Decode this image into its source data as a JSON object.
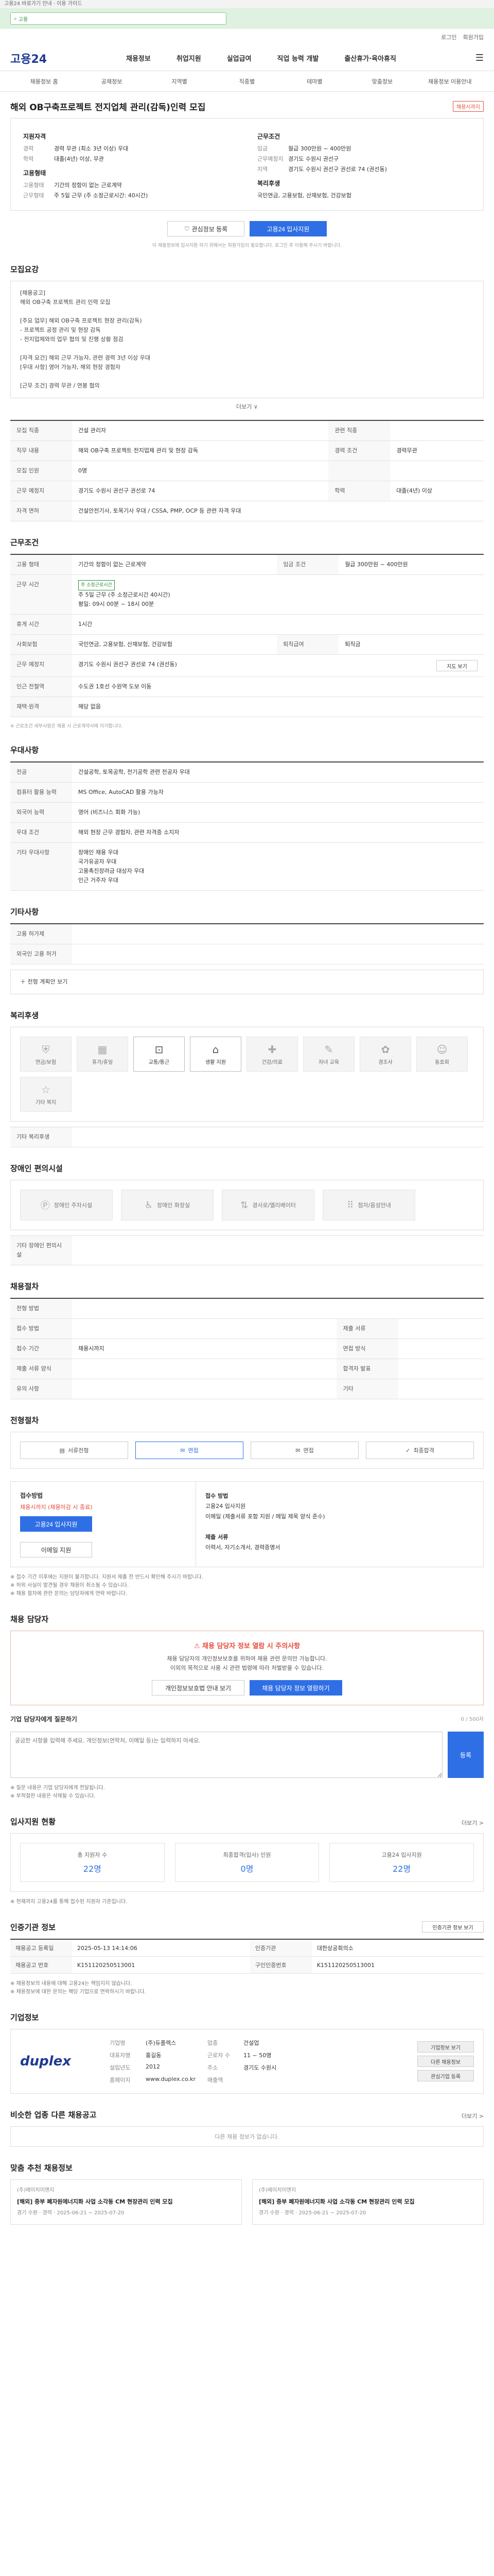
{
  "topbar": {
    "text": "고용24 바로가기 안내 · 이용 가이드"
  },
  "topsearch": {
    "label": "고용"
  },
  "util": [
    "로그인",
    "회원가입"
  ],
  "header": {
    "logo": "고용24",
    "nav": [
      "채용정보",
      "취업지원",
      "실업급여",
      "직업 능력 개발",
      "출산휴가·육아휴직"
    ]
  },
  "subnav": [
    "채용정보 홈",
    "공채정보",
    "지역별",
    "직종별",
    "테마별",
    "맞춤정보",
    "채용정보 이용안내"
  ],
  "job": {
    "title": "해외 OB구축프로젝트 전지업체 관리(감독)인력 모집",
    "badge": "채용시까지",
    "summary": {
      "left_title": "지원자격",
      "left": [
        {
          "k": "경력",
          "v": "경력 무관 (최소 3년 이상) 우대"
        },
        {
          "k": "학력",
          "v": "대졸(4년) 이상, 무관"
        }
      ],
      "left_title2": "고용형태",
      "left2": [
        {
          "k": "고용형태",
          "v": "기간의 정함이 없는 근로계약"
        },
        {
          "k": "근무형태",
          "v": "주 5일 근무 (주 소정근로시간: 40시간)"
        }
      ],
      "right_title": "근무조건",
      "right": [
        {
          "k": "임금",
          "v": "월급 300만원 ~ 400만원"
        },
        {
          "k": "근무예정지",
          "v": "경기도 수원시 권선구"
        },
        {
          "k": "지역",
          "v": "경기도 수원시 권선구 권선로 74 (권선동)"
        }
      ],
      "right_title2": "복리후생",
      "right2": [
        {
          "k": "",
          "v": "국민연금, 고용보험, 산재보험, 건강보험"
        }
      ]
    },
    "btn_interest": "관심정보 등록",
    "btn_apply": "고용24 입사지원",
    "note": "이 채용정보에 입사지원 하기 위해서는 회원가입이 필요합니다. 로그인 후 이용해 주시기 바랍니다."
  },
  "recruit": {
    "h": "모집요강",
    "lines": [
      "[채용공고]",
      "해외 OB구축 프로젝트 관리 인력 모집",
      "",
      "[주요 업무] 해외 OB구축 프로젝트 현장 관리(감독)",
      "- 프로젝트 공정 관리 및 현장 감독",
      "- 전지업체와의 업무 협의 및 진행 상황 점검",
      "",
      "[자격 요건] 해외 근무 가능자, 관련 경력 3년 이상 우대",
      "[우대 사항] 영어 가능자, 해외 현장 경험자",
      "",
      "[근무 조건] 경력 무관 / 연봉 협의"
    ],
    "more": "더보기 ∨"
  },
  "detail": {
    "rows1": [
      [
        {
          "k": "모집 직종",
          "v": "건설 관리자"
        },
        {
          "k": "관련 직종",
          "v": ""
        }
      ],
      [
        {
          "k": "직무 내용",
          "v": "해외 OB구축 프로젝트 전지업체 관리 및 현장 감독"
        },
        {
          "k": "경력 조건",
          "v": "경력무관"
        }
      ],
      [
        {
          "k": "모집 인원",
          "v": "0명"
        },
        {
          "k": "",
          "v": ""
        }
      ],
      [
        {
          "k": "근무 예정지",
          "v": "경기도 수원시 권선구 권선로 74"
        },
        {
          "k": "학력",
          "v": "대졸(4년) 이상"
        }
      ],
      [
        {
          "k": "자격 면허",
          "v": "건설안전기사, 토목기사 우대 / CSSA, PMP, OCP 등 관련 자격 우대"
        },
        {
          "k": "",
          "v": ""
        }
      ]
    ]
  },
  "conditions": {
    "h": "근무조건",
    "emp_type": "기간의 정함이 없는 근로계약",
    "wage": "월급 300만원 ~ 400만원",
    "hours_chip": "주 소정근로시간",
    "hours": "주 5일 근무 (주 소정근로시간 40시간)",
    "hours_detail": "평일: 09시 00분 ~ 18시 00분",
    "rows": [
      {
        "k": "휴게 시간",
        "v": "1시간"
      },
      {
        "k": "사회보험",
        "v": "국민연금, 고용보험, 산재보험, 건강보험"
      },
      {
        "k": "퇴직급여",
        "v": "퇴직금"
      },
      {
        "k": "근무 예정지",
        "v": "경기도 수원시 권선구 권선로 74 (권선동)"
      },
      {
        "k": "인근 전철역",
        "v": "수도권 1호선 수원역 도보 이동"
      },
      {
        "k": "재택·원격",
        "v": "해당 없음"
      }
    ],
    "map_btn": "지도 보기",
    "note": "※ 근로조건 세부사항은 채용 시 근로계약서에 의거합니다."
  },
  "welfare": {
    "h": "우대사항",
    "rows": [
      {
        "k": "전공",
        "v": "건설공학, 토목공학, 전기공학 관련 전공자 우대"
      },
      {
        "k": "컴퓨터 활용 능력",
        "v": "MS Office, AutoCAD 활용 가능자"
      },
      {
        "k": "외국어 능력",
        "v": "영어 (비즈니스 회화 가능)"
      },
      {
        "k": "우대 조건",
        "v": "해외 현장 근무 경험자, 관련 자격증 소지자"
      },
      {
        "k": "기타 우대사항",
        "v": "장애인 채용 우대\n국가유공자 우대\n고용촉진장려금 대상자 우대\n인근 거주자 우대"
      }
    ]
  },
  "other": {
    "h": "기타사항",
    "rows": [
      {
        "k": "고용 허가제",
        "v": ""
      },
      {
        "k": "외국인 고용 허가",
        "v": ""
      }
    ],
    "btn": "전형 계획안 보기"
  },
  "benefits": {
    "h": "복리후생",
    "items": [
      {
        "n": "연금/보험",
        "on": false
      },
      {
        "n": "휴가/휴일",
        "on": false
      },
      {
        "n": "교통/통근",
        "on": true
      },
      {
        "n": "생활 지원",
        "on": true
      },
      {
        "n": "건강/의료",
        "on": false
      },
      {
        "n": "자녀 교육",
        "on": false
      },
      {
        "n": "경조사",
        "on": false
      },
      {
        "n": "동호회",
        "on": false
      },
      {
        "n": "기타 복지",
        "on": false
      }
    ],
    "sub_h": "기타 복리후생",
    "sub_v": ""
  },
  "disability": {
    "h": "장애인 편의시설",
    "items": [
      "장애인 주차시설",
      "장애인 화장실",
      "경사로/엘리베이터",
      "점자/음성안내"
    ],
    "sub_h": "기타 장애인 편의시설",
    "sub_v": ""
  },
  "selection": {
    "h": "채용절차",
    "rows": [
      {
        "k": "전형 방법",
        "v": ""
      },
      {
        "k": "접수 방법",
        "v": "",
        "k2": "제출 서류",
        "v2": ""
      },
      {
        "k": "접수 기간",
        "v": "채용시까지",
        "k2": "면접 방식",
        "v2": ""
      },
      {
        "k": "제출 서류 양식",
        "v": "",
        "k2": "합격자 발표",
        "v2": ""
      },
      {
        "k": "유의 사항",
        "v": "",
        "k2": "기타",
        "v2": ""
      }
    ]
  },
  "process": {
    "h": "전형절차",
    "steps": [
      "서류전형",
      "면접",
      "면접",
      "최종합격"
    ],
    "active": 1
  },
  "apply": {
    "h_left": "접수방법",
    "deadline_label": "채용시까지 (채용마감 시 종료)",
    "btn_apply": "고용24 입사지원",
    "btn_email": "이메일 지원",
    "right_title": "접수 방법",
    "right": [
      "고용24 입사지원",
      "이메일 (제출서류 포함 지원 / 메일 제목 양식 준수)",
      "",
      "제출 서류",
      "이력서, 자기소개서, 경력증명서"
    ],
    "notes": [
      "※ 접수 기간 이후에는 지원이 불가합니다. 지원서 제출 전 반드시 확인해 주시기 바랍니다.",
      "※ 허위 사실이 발견될 경우 채용이 취소될 수 있습니다.",
      "※ 채용 절차에 관한 문의는 담당자에게 연락 바랍니다."
    ]
  },
  "contact": {
    "h": "채용 담당자",
    "warn_title": "채용 담당자 정보 열람 시 주의사항",
    "warn_lines": [
      "채용 담당자의 개인정보보호를 위하여 채용 관련 문의만 가능합니다.",
      "이외의 목적으로 사용 시 관련 법령에 따라 처벌받을 수 있습니다."
    ],
    "btn1": "개인정보보호법 안내 보기",
    "btn2": "채용 담당자 정보 열람하기",
    "qna_h": "기업 담당자에게 질문하기",
    "qna_count": "0 / 500자",
    "qna_placeholder": "궁금한 사항을 입력해 주세요. 개인정보(연락처, 이메일 등)는 입력하지 마세요.",
    "qna_btn": "등록",
    "qna_notes": [
      "※ 질문 내용은 기업 담당자에게 전달됩니다.",
      "※ 부적절한 내용은 삭제될 수 있습니다."
    ]
  },
  "stats": {
    "h": "입사지원 현황",
    "more": "더보기 >",
    "items": [
      {
        "l": "총 지원자 수",
        "n": "22명"
      },
      {
        "l": "최종합격(입사) 인원",
        "n": "0명"
      },
      {
        "l": "고용24 입사지원",
        "n": "22명"
      }
    ],
    "note": "※ 현재까지 고용24를 통해 접수된 지원자 기준입니다."
  },
  "notice": {
    "h": "인증기관 정보",
    "btn": "인증기관 정보 보기",
    "rows": [
      {
        "k": "채용공고 등록일",
        "v": "2025-05-13 14:14:06",
        "k2": "인증기관",
        "v2": "대한상공회의소"
      },
      {
        "k": "채용공고 번호",
        "v": "K151120250513001",
        "k2": "구인인증번호",
        "v2": "K151120250513001"
      }
    ],
    "notes": [
      "※ 채용정보의 내용에 대해 고용24는 책임지지 않습니다.",
      "※ 채용정보에 대한 문의는 해당 기업으로 연락하시기 바랍니다."
    ]
  },
  "company": {
    "h": "기업정보",
    "logo_a": "du",
    "logo_b": "plex",
    "fields": [
      {
        "k": "기업명",
        "v": "(주)듀플렉스"
      },
      {
        "k": "업종",
        "v": "건설업"
      },
      {
        "k": "대표자명",
        "v": "홍길동"
      },
      {
        "k": "근로자 수",
        "v": "11 ~ 50명"
      },
      {
        "k": "설립년도",
        "v": "2012"
      },
      {
        "k": "주소",
        "v": "경기도 수원시"
      },
      {
        "k": "홈페이지",
        "v": "www.duplex.co.kr"
      },
      {
        "k": "매출액",
        "v": ""
      }
    ],
    "btns": [
      "기업정보 보기",
      "다른 채용정보",
      "관심기업 등록"
    ]
  },
  "similar": {
    "h": "비슷한 업종 다른 채용공고",
    "more": "더보기 >",
    "empty": "다른 채용 정보가 없습니다."
  },
  "recommended": {
    "h": "맞춤 추천 채용정보",
    "cards": [
      {
        "comp": "(주)에이치이앤지",
        "title": "[해외] 중부 폐자원에너지화 사업 소각동 CM 현장관리 인력 모집",
        "meta": "경기 수원 · 경력 · 2025-06-21 ~ 2025-07-20"
      },
      {
        "comp": "(주)에이치이앤지",
        "title": "[해외] 중부 폐자원에너지화 사업 소각동 CM 현장관리 인력 모집",
        "meta": "경기 수원 · 경력 · 2025-06-21 ~ 2025-07-20"
      }
    ]
  }
}
